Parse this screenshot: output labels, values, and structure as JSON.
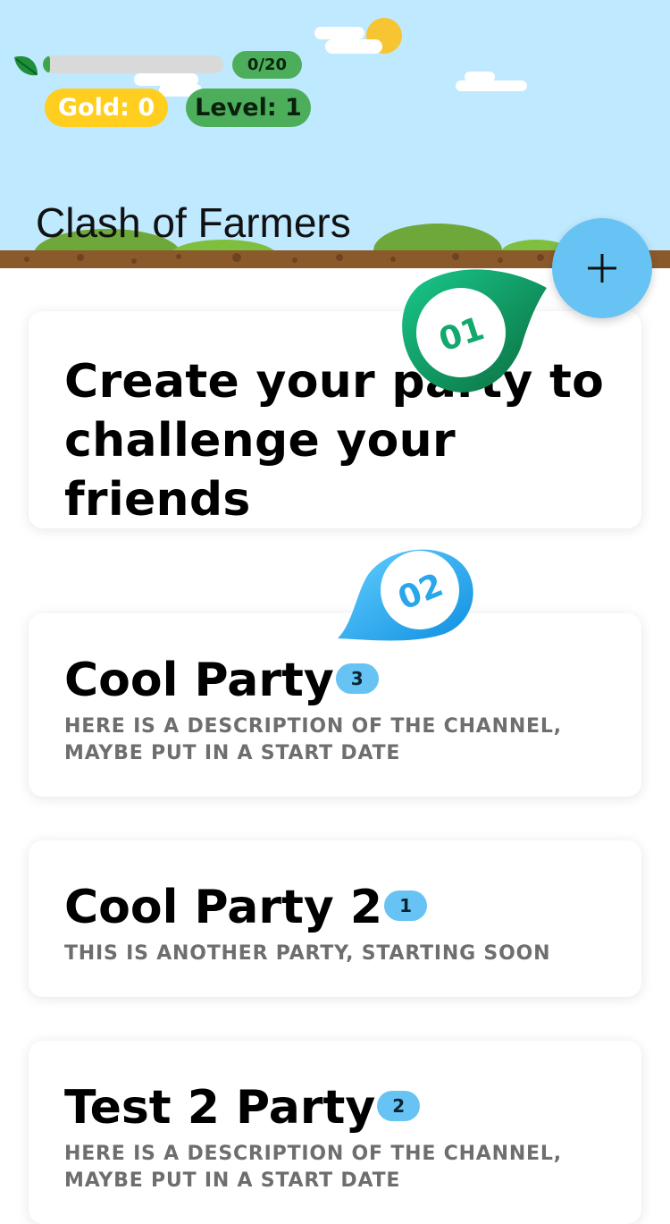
{
  "header": {
    "app_title": "Clash of Farmers",
    "xp": {
      "text": "0/20",
      "fraction": 0.0,
      "icon": "leaf-icon"
    },
    "gold_label": "Gold: 0",
    "level_label": "Level: 1"
  },
  "fab": {
    "icon": "plus-icon"
  },
  "create_card": {
    "text": "Create your party to challenge your friends"
  },
  "markers": [
    {
      "label": "01",
      "icon": "step-marker-icon",
      "color": "#12b07a"
    },
    {
      "label": "02",
      "icon": "step-marker-icon",
      "color": "#1aa8ef"
    }
  ],
  "parties": [
    {
      "name": "Cool Party",
      "count": "3",
      "description": "HERE IS A DESCRIPTION OF THE CHANNEL, MAYBE PUT IN A START DATE"
    },
    {
      "name": "Cool Party 2",
      "count": "1",
      "description": "THIS IS ANOTHER PARTY, STARTING SOON"
    },
    {
      "name": "Test 2 Party",
      "count": "2",
      "description": "HERE IS A DESCRIPTION OF THE CHANNEL, MAYBE PUT IN A START DATE"
    }
  ],
  "colors": {
    "sky": "#bfe9fe",
    "gold": "#ffce1f",
    "green": "#4cae5a",
    "accent_blue": "#66c3f3",
    "dirt": "#8b5a2b"
  }
}
